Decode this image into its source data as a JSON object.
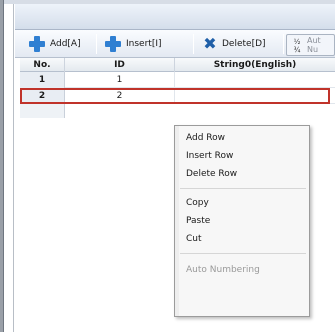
{
  "toolbar": {
    "buttons": [
      {
        "label": "Add[A]",
        "icon": "plus-icon"
      },
      {
        "label": "Insert[I]",
        "icon": "plus-icon"
      },
      {
        "label": "Delete[D]",
        "icon": "close-x-icon"
      },
      {
        "label_top": "Aut",
        "label_bottom": "Nu",
        "icon": "numbering-icon"
      }
    ]
  },
  "grid": {
    "columns": [
      "No.",
      "ID",
      "String0(English)"
    ],
    "rows": [
      {
        "no": "1",
        "id": "1"
      },
      {
        "no": "2",
        "id": "2"
      }
    ]
  },
  "context_menu": {
    "items": [
      "Add Row",
      "Insert Row",
      "Delete Row",
      "Copy",
      "Paste",
      "Cut",
      "Auto Numbering"
    ]
  },
  "colors": {
    "selection_outline": "#c0332a",
    "accent_blue": "#2f7fd2"
  }
}
